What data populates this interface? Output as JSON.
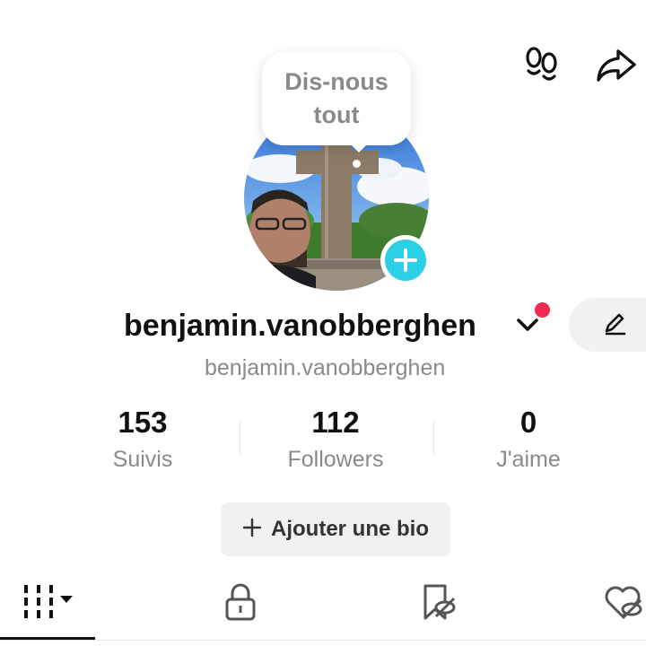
{
  "header": {
    "footprints_icon": "footprints-icon",
    "share_icon": "share-arrow-icon"
  },
  "bubble": {
    "text": "Dis-nous tout"
  },
  "profile": {
    "username": "benjamin.vanobberghen",
    "handle": "benjamin.vanobberghen",
    "avatar_icon": "profile-photo",
    "add_photo_icon": "plus-icon",
    "notification_dot_color": "#ef2950",
    "accent_color": "#2bd0e6"
  },
  "stats": [
    {
      "value": "153",
      "label": "Suivis"
    },
    {
      "value": "112",
      "label": "Followers"
    },
    {
      "value": "0",
      "label": "J'aime"
    }
  ],
  "bio_button": {
    "label": "Ajouter une bio",
    "icon": "plus-icon"
  },
  "tabs": [
    {
      "name": "videos",
      "icon": "grid-icon",
      "active": true
    },
    {
      "name": "private",
      "icon": "lock-icon",
      "active": false
    },
    {
      "name": "saved",
      "icon": "bookmark-eye-off-icon",
      "active": false
    },
    {
      "name": "liked",
      "icon": "heart-eye-off-icon",
      "active": false
    }
  ]
}
